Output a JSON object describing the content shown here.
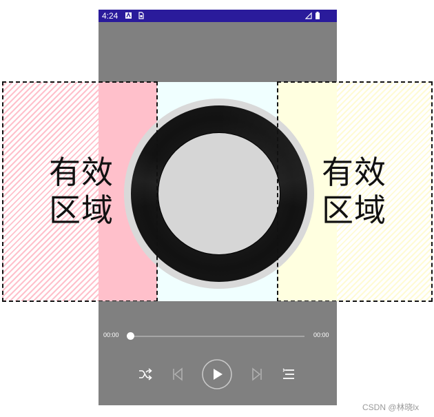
{
  "status_bar": {
    "time": "4:24",
    "color": "#2a1b9b"
  },
  "effective_zone": {
    "left": {
      "line1": "有效",
      "line2": "区域"
    },
    "right": {
      "line1": "有效",
      "line2": "区域"
    }
  },
  "colors": {
    "left_zone": "#ffc0cb",
    "center_zone": "#f0ffff",
    "right_zone": "#ffffe0",
    "player_background": "#808080"
  },
  "player": {
    "elapsed_time": "00:00",
    "total_time": "00:00",
    "progress": 0,
    "controls": [
      "shuffle-icon",
      "previous-icon",
      "play-icon",
      "next-icon",
      "playlist-icon"
    ]
  },
  "watermark": "CSDN @林晓lx"
}
